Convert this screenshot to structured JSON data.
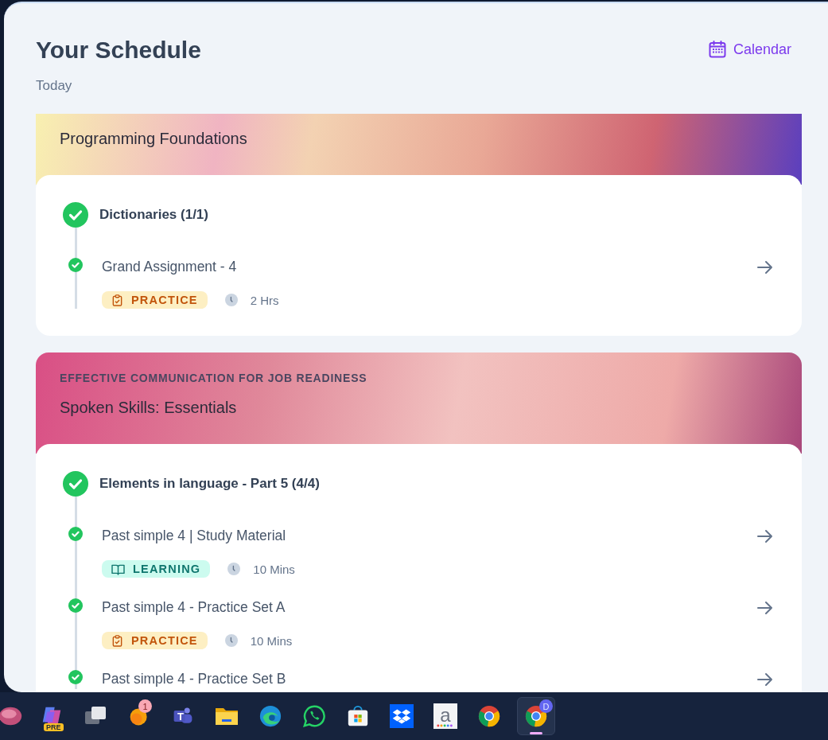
{
  "header": {
    "title": "Your Schedule",
    "subtitle": "Today",
    "calendar_link": "Calendar"
  },
  "courses": [
    {
      "kind": "sunset",
      "title": "Programming Foundations",
      "groups": [
        {
          "title": "Dictionaries (1/1)",
          "completed": true,
          "items": [
            {
              "title": "Grand Assignment - 4",
              "completed": true,
              "kind": "practice",
              "tag": "PRACTICE",
              "duration": "2 Hrs"
            }
          ]
        }
      ]
    },
    {
      "kind": "rose",
      "category": "EFFECTIVE COMMUNICATION FOR JOB READINESS",
      "title": "Spoken Skills: Essentials",
      "groups": [
        {
          "title": "Elements in language - Part 5 (4/4)",
          "completed": true,
          "items": [
            {
              "title": "Past simple 4 | Study Material",
              "completed": true,
              "kind": "learning",
              "tag": "LEARNING",
              "duration": "10 Mins"
            },
            {
              "title": "Past simple 4 - Practice Set A",
              "completed": true,
              "kind": "practice",
              "tag": "PRACTICE",
              "duration": "10 Mins"
            },
            {
              "title": "Past simple 4 - Practice Set B",
              "completed": true
            }
          ]
        }
      ]
    }
  ],
  "taskbar": [
    {
      "kind": "blob",
      "selected": false
    },
    {
      "kind": "copilot",
      "label": "PRE",
      "selected": false
    },
    {
      "kind": "windows",
      "selected": false
    },
    {
      "kind": "orb",
      "badge": "1",
      "selected": false
    },
    {
      "kind": "teams",
      "label": "T",
      "selected": false
    },
    {
      "kind": "folder",
      "selected": false
    },
    {
      "kind": "edge",
      "selected": false
    },
    {
      "kind": "whatsapp",
      "selected": false
    },
    {
      "kind": "store",
      "selected": false
    },
    {
      "kind": "dropbox",
      "selected": false
    },
    {
      "kind": "amazon",
      "label": "a",
      "selected": false
    },
    {
      "kind": "chrome",
      "selected": false
    },
    {
      "kind": "chrome",
      "badge": "D",
      "selected": true
    }
  ]
}
